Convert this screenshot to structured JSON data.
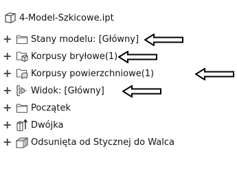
{
  "tree": {
    "root": {
      "label": "4-Model-Szkicowe.ipt",
      "icon": "part-cube-icon"
    },
    "expander_glyph": "+",
    "items": [
      {
        "label": "Stany modelu: [Główny]",
        "icon": "folder-icon",
        "highlighted": true
      },
      {
        "label": "Korpusy bryłowe(1)",
        "icon": "solid-bodies-folder-icon",
        "highlighted": true
      },
      {
        "label": "Korpusy powierzchniowe(1)",
        "icon": "surface-bodies-folder-icon",
        "highlighted": true
      },
      {
        "label": "Widok: [Główny]",
        "icon": "view-icon",
        "highlighted": true
      },
      {
        "label": "Początek",
        "icon": "folder-icon",
        "highlighted": false
      },
      {
        "label": "Dwójka",
        "icon": "extrude-feature-icon",
        "highlighted": false
      },
      {
        "label": "Odsunięta od Stycznej do Walca",
        "icon": "work-plane-feature-icon",
        "highlighted": false
      }
    ]
  },
  "colors": {
    "text": "#111111",
    "icon_stroke": "#444444",
    "arrow": "#000000"
  }
}
